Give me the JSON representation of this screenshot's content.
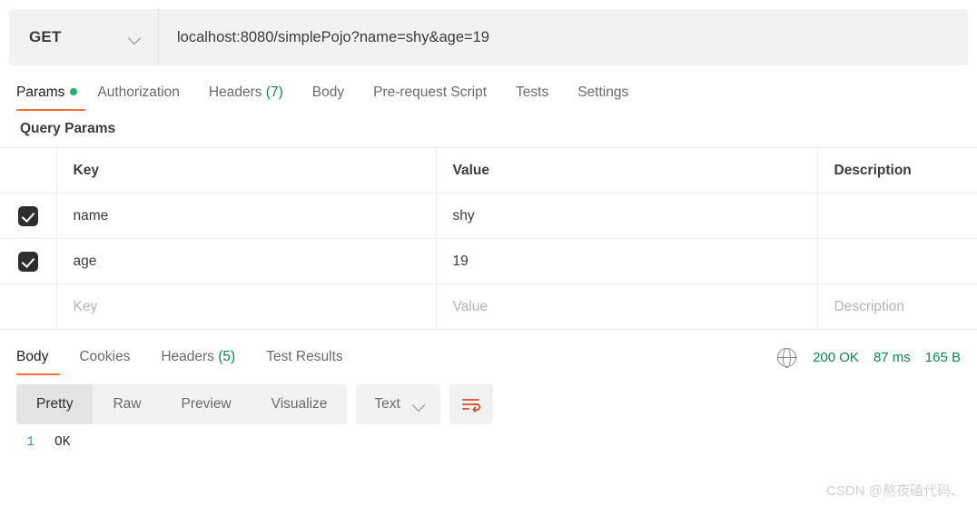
{
  "request": {
    "method": "GET",
    "url": "localhost:8080/simplePojo?name=shy&age=19",
    "method_chevron_icon": "chevron-down-icon",
    "tabs": [
      {
        "label": "Params",
        "active": true,
        "has_dot": true,
        "count": ""
      },
      {
        "label": "Authorization",
        "active": false,
        "has_dot": false,
        "count": ""
      },
      {
        "label": "Headers",
        "active": false,
        "has_dot": false,
        "count": "(7)"
      },
      {
        "label": "Body",
        "active": false,
        "has_dot": false,
        "count": ""
      },
      {
        "label": "Pre-request Script",
        "active": false,
        "has_dot": false,
        "count": ""
      },
      {
        "label": "Tests",
        "active": false,
        "has_dot": false,
        "count": ""
      },
      {
        "label": "Settings",
        "active": false,
        "has_dot": false,
        "count": ""
      }
    ]
  },
  "query_params": {
    "section_title": "Query Params",
    "columns": [
      "Key",
      "Value",
      "Description"
    ],
    "rows": [
      {
        "checked": true,
        "key": "name",
        "value": "shy",
        "description": ""
      },
      {
        "checked": true,
        "key": "age",
        "value": "19",
        "description": ""
      }
    ],
    "empty_row": {
      "key_placeholder": "Key",
      "value_placeholder": "Value",
      "description_placeholder": "Description"
    }
  },
  "response": {
    "tabs": [
      {
        "label": "Body",
        "active": true,
        "count": ""
      },
      {
        "label": "Cookies",
        "active": false,
        "count": ""
      },
      {
        "label": "Headers",
        "active": false,
        "count": "(5)"
      },
      {
        "label": "Test Results",
        "active": false,
        "count": ""
      }
    ],
    "meta": {
      "globe_icon": "globe-icon",
      "status": "200 OK",
      "time": "87 ms",
      "size": "165 B"
    },
    "viewer": {
      "modes": [
        {
          "label": "Pretty",
          "active": true
        },
        {
          "label": "Raw",
          "active": false
        },
        {
          "label": "Preview",
          "active": false
        },
        {
          "label": "Visualize",
          "active": false
        }
      ],
      "format": "Text",
      "format_chevron_icon": "chevron-down-icon",
      "wrap_icon": "word-wrap-icon"
    },
    "body_lines": [
      {
        "number": "1",
        "text": "OK"
      }
    ]
  },
  "watermark": "CSDN @熬夜磕代码、",
  "colors": {
    "accent": "#ff6c37",
    "success": "#0b8a4b",
    "dot": "#17b26a",
    "line_number": "#3d8fd1",
    "panel": "#f2f2f2"
  }
}
